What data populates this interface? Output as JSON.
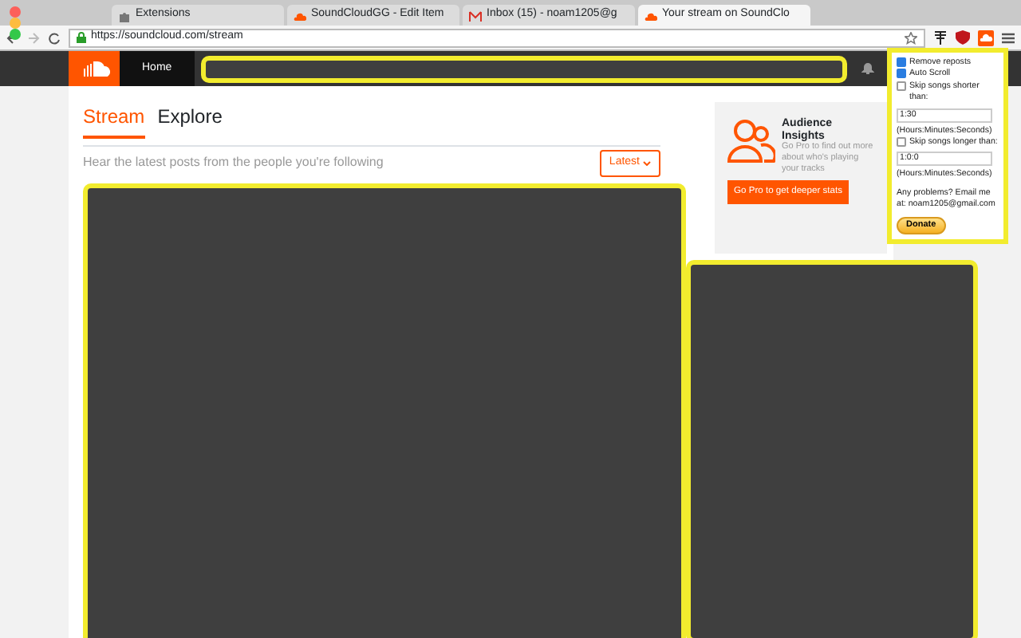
{
  "browser": {
    "tabs": [
      {
        "label": "Extensions",
        "selected": false
      },
      {
        "label": "SoundCloudGG - Edit Item",
        "selected": false
      },
      {
        "label": "Inbox (15) - noam1205@g",
        "selected": false
      },
      {
        "label": "Your stream on SoundClo",
        "selected": true
      }
    ],
    "url": "https://soundcloud.com/stream"
  },
  "header": {
    "nav": [
      {
        "label": "Home",
        "selected": true
      }
    ]
  },
  "stream": {
    "tabs": [
      {
        "label": "Stream",
        "selected": true
      },
      {
        "label": "Explore",
        "selected": false
      }
    ],
    "subtitle": "Hear the latest posts from the people you're following",
    "sort_button": "Latest"
  },
  "promo": {
    "title": "Audience Insights",
    "text": "Go Pro to find out more about who's playing your tracks",
    "button": "Go Pro to get deeper stats"
  },
  "popup": {
    "rows": [
      {
        "kind": "checkbox",
        "label": "Remove reposts",
        "checked": true
      },
      {
        "kind": "checkbox",
        "label": "Auto Scroll",
        "checked": true
      },
      {
        "kind": "checkbox",
        "label": "Skip songs shorter than:",
        "checked": false
      },
      {
        "kind": "field",
        "value": "1:30"
      },
      {
        "kind": "note",
        "text": "(Hours:Minutes:Seconds)"
      },
      {
        "kind": "checkbox",
        "label": "Skip songs longer than:",
        "checked": false
      },
      {
        "kind": "field",
        "value": "1:0:0"
      },
      {
        "kind": "note",
        "text": "(Hours:Minutes:Seconds)"
      },
      {
        "kind": "note",
        "text": "Any problems? Email me at: noam1205@gmail.com"
      },
      {
        "kind": "button",
        "label": "Donate"
      }
    ]
  }
}
